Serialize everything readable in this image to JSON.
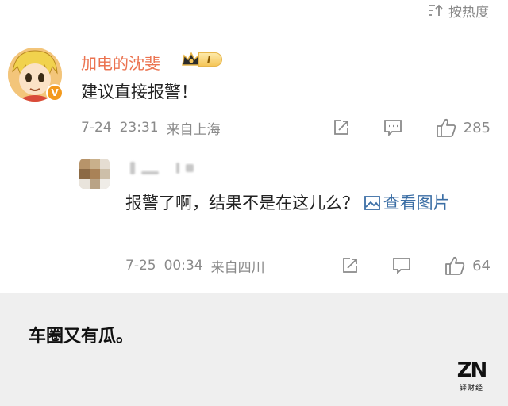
{
  "sort": {
    "label": "按热度",
    "icon": "sort-icon"
  },
  "comments": [
    {
      "author": "加电的沈斐",
      "badge_level": "I",
      "verified_mark": "V",
      "text": "建议直接报警！",
      "date": "7-24",
      "time": "23:31",
      "location": "来自上海",
      "likes": "285",
      "icons": [
        "repost-icon",
        "comment-icon",
        "like-icon"
      ]
    },
    {
      "author": "",
      "text_prefix": "报警了啊，结果不是在这儿么？",
      "link_text": "查看图片",
      "link_icon": "image-icon",
      "date": "7-25",
      "time": "00:34",
      "location": "来自四川",
      "likes": "64",
      "icons": [
        "repost-icon",
        "comment-icon",
        "like-icon"
      ]
    }
  ],
  "caption": {
    "text": "车圈又有瓜。"
  },
  "watermark": {
    "mark": "ZN",
    "sub": "铎财经"
  },
  "colors": {
    "name": "#eb7350",
    "link": "#3b6ea5",
    "meta": "#8a8a8a",
    "caption_bg": "#efefef"
  }
}
